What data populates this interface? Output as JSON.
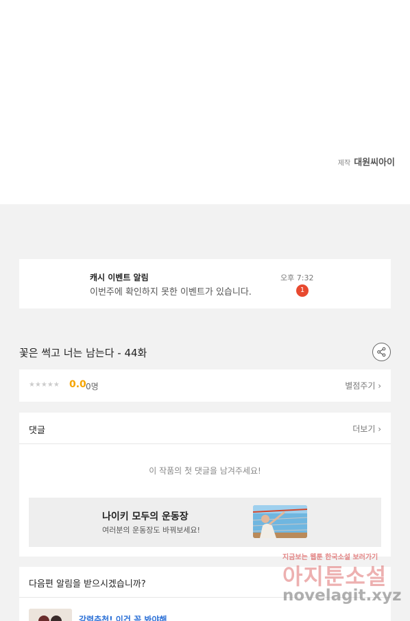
{
  "producer": {
    "label": "제작",
    "name": "대원씨아이"
  },
  "notification": {
    "title": "캐시 이벤트 알림",
    "message": "이번주에 확인하지 못한 이벤트가 있습니다.",
    "time": "오후 7:32",
    "badge_count": "1"
  },
  "episode": {
    "title": "꽃은 썩고 너는 남는다 - 44화"
  },
  "rating": {
    "stars": "★★★★★",
    "score": "0.0",
    "count": "0명",
    "rate_label": "별점주기 ›"
  },
  "comments": {
    "title": "댓글",
    "more_label": "더보기 ›",
    "empty_message": "이 작품의 첫 댓글을 남겨주세요!"
  },
  "ad": {
    "title": "나이키 모두의 운동장",
    "subtitle": "여러분의 운동장도 바꿔보세요!"
  },
  "next_episode": {
    "title": "다음편 알림을 받으시겠습니까?",
    "recommend_label": "강력추천! 이건 꼭 봐야해"
  },
  "watermark": {
    "small": "지금보는 웹툰 한국소설 보러가기",
    "big": "아지툰소설",
    "url": "novelagit.xyz"
  },
  "colors": {
    "accent_orange": "#f5a400",
    "badge_red": "#e8492f",
    "link_blue": "#2a6fd6"
  }
}
